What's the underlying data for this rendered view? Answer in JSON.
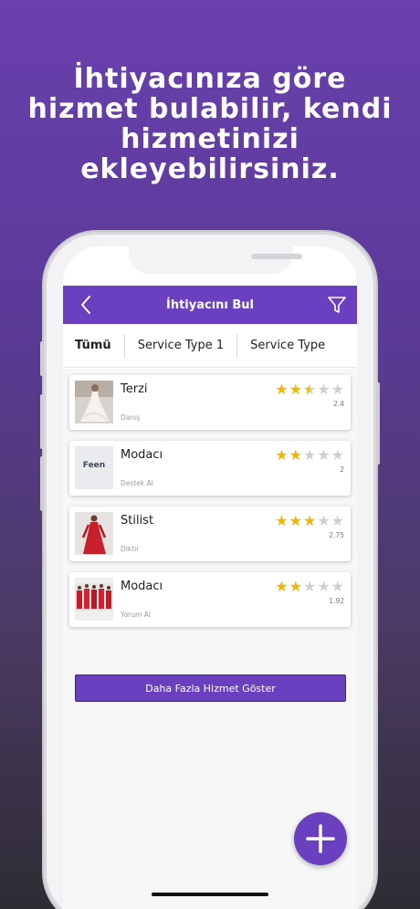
{
  "headline": {
    "line1": "İhtiyacınıza göre",
    "line2": "hizmet bulabilir, kendi",
    "line3": "hizmetinizi",
    "line4": "ekleyebilirsiniz."
  },
  "navbar": {
    "title": "İhtiyacını Bul",
    "back_icon": "chevron-left-icon",
    "filter_icon": "filter-icon"
  },
  "tabs": [
    {
      "label": "Tümü",
      "active": true
    },
    {
      "label": "Service Type 1",
      "active": false
    },
    {
      "label": "Service Type",
      "active": false
    }
  ],
  "services": [
    {
      "title": "Terzi",
      "subtitle": "Danış",
      "rating": "2.4",
      "stars": 2.4,
      "thumb": "wedding-dress"
    },
    {
      "title": "Modacı",
      "subtitle": "Destek Al",
      "rating": "2",
      "stars": 2,
      "thumb": "feen-logo",
      "thumb_text": "Feen"
    },
    {
      "title": "Stilist",
      "subtitle": "Diktir",
      "rating": "2.75",
      "stars": 2.75,
      "thumb": "red-dress"
    },
    {
      "title": "Modacı",
      "subtitle": "Yorum Al",
      "rating": "1.92",
      "stars": 1.92,
      "thumb": "red-models"
    }
  ],
  "more_button": "Daha Fazla Hizmet Göster",
  "colors": {
    "primary": "#6a3fc0",
    "star": "#f4b400",
    "star_empty": "#cfcfcf"
  }
}
